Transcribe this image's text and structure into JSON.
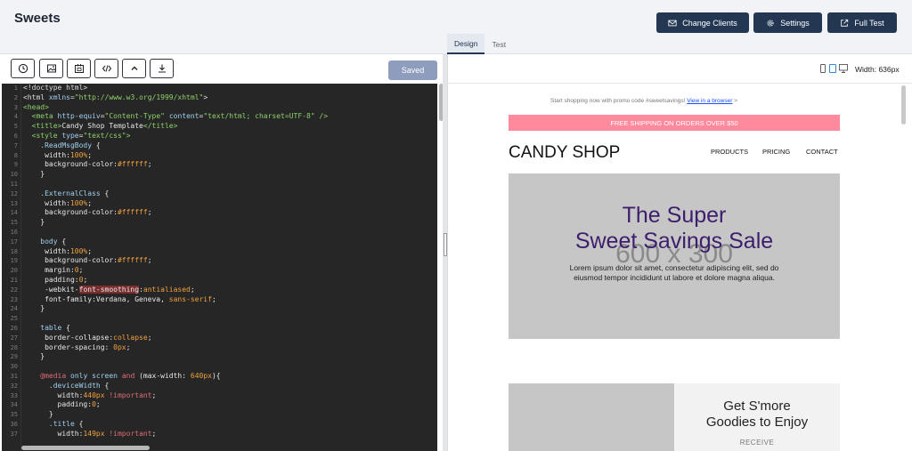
{
  "app": {
    "title": "Sweets"
  },
  "header": {
    "change_clients": "Change Clients",
    "settings": "Settings",
    "full_test": "Full Test"
  },
  "tabs": {
    "design": "Design",
    "test": "Test"
  },
  "toolbar": {
    "saved": "Saved"
  },
  "editor": {
    "line_numbers": [
      "1",
      "2",
      "3",
      "4",
      "5",
      "6",
      "7",
      "8",
      "9",
      "10",
      "11",
      "12",
      "13",
      "14",
      "15",
      "16",
      "17",
      "18",
      "19",
      "20",
      "21",
      "22",
      "23",
      "24",
      "25",
      "26",
      "27",
      "28",
      "29",
      "30",
      "31",
      "32",
      "33",
      "34",
      "35",
      "36",
      "37"
    ]
  },
  "preview_header": {
    "width_label": "Width: 636px"
  },
  "preview": {
    "promo_text": "Start shopping now with promo code #sweetsavings! ",
    "promo_link": "View in a browser",
    "promo_after": " >",
    "shipping": "FREE SHIPPING ON ORDERS OVER $50",
    "brand": "CANDY SHOP",
    "nav": {
      "products": "PRODUCTS",
      "pricing": "PRICING",
      "contact": "CONTACT"
    },
    "hero_placeholder": "600 x 300",
    "hero_title_1": "The Super",
    "hero_title_2": "Sweet Savings Sale",
    "hero_text": "Lorem ipsum dolor sit amet, consectetur adipiscing elit, sed do eiusmod tempor incididunt ut labore et dolore magna aliqua.",
    "card_title_1": "Get S'more",
    "card_title_2": "Goodies to Enjoy",
    "card_receive": "RECEIVE"
  },
  "colors": {
    "navy": "#233753",
    "pink": "#ff8a9d",
    "purple": "#3d1e6d",
    "editor_bg": "#262626"
  }
}
